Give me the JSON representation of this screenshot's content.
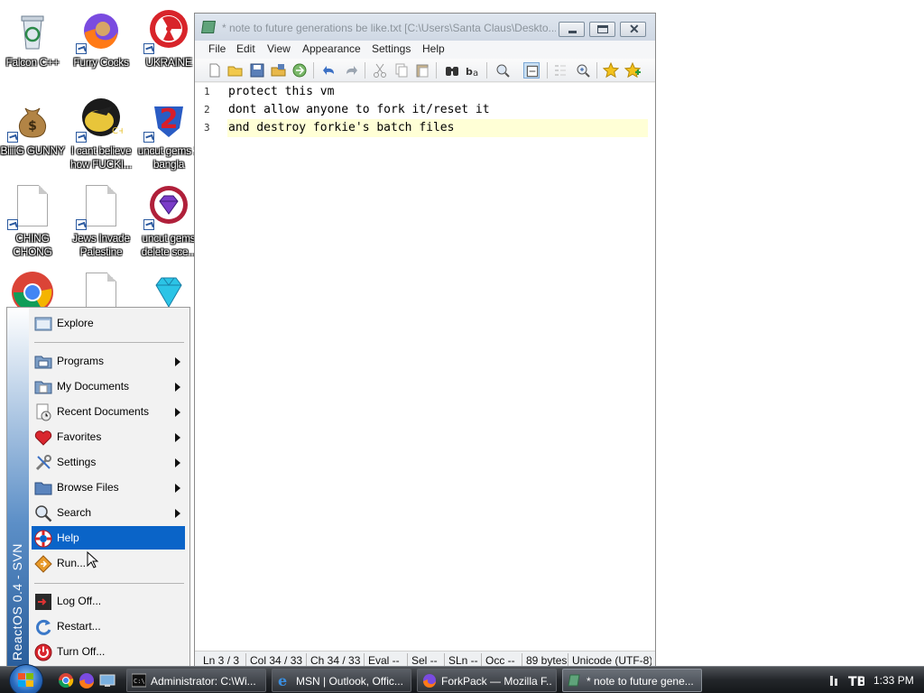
{
  "desktop": {
    "icons": [
      {
        "label": "Falcon C++",
        "icon": "recycle-bin-icon"
      },
      {
        "label": "Furry Cocks",
        "icon": "firefox-icon"
      },
      {
        "label": "UKRAINE",
        "icon": "radiation-icon"
      },
      {
        "label": "BiiiiG GUNNY",
        "icon": "money-bag-icon"
      },
      {
        "label": "I cant believe how FUCKI...",
        "icon": "chick-icon"
      },
      {
        "label": "uncut gems 2 bangla",
        "icon": "number-two-icon"
      },
      {
        "label": "CHING CHONG",
        "icon": "document-icon"
      },
      {
        "label": "Jews Invade Palestine",
        "icon": "document-icon"
      },
      {
        "label": "uncut gems delete sce...",
        "icon": "gem-icon"
      }
    ]
  },
  "editor": {
    "title": "* note to future generations be like.txt [C:\\Users\\Santa Claus\\Deskto...",
    "menu": [
      "File",
      "Edit",
      "View",
      "Appearance",
      "Settings",
      "Help"
    ],
    "lines": [
      {
        "num": "1",
        "text": "protect this vm"
      },
      {
        "num": "2",
        "text": "dont allow anyone to fork it/reset it"
      },
      {
        "num": "3",
        "text": "and destroy forkie's batch files"
      }
    ],
    "status": {
      "ln": "Ln 3 / 3",
      "col": "Col 34 / 33",
      "ch": "Ch 34 / 33",
      "eval": "Eval --",
      "sel": "Sel --",
      "sln": "SLn --",
      "occ": "Occ --",
      "size": "89 bytes",
      "encoding": "Unicode (UTF-8)"
    }
  },
  "start_menu": {
    "brand": "ReactOS 0.4 - SVN",
    "items": [
      {
        "label": "Explore",
        "icon": "explorer-icon"
      },
      {
        "label": "Programs",
        "icon": "programs-folder-icon",
        "submenu": true
      },
      {
        "label": "My Documents",
        "icon": "documents-folder-icon",
        "submenu": true
      },
      {
        "label": "Recent Documents",
        "icon": "recent-documents-icon",
        "submenu": true
      },
      {
        "label": "Favorites",
        "icon": "heart-icon",
        "submenu": true
      },
      {
        "label": "Settings",
        "icon": "settings-tools-icon",
        "submenu": true
      },
      {
        "label": "Browse Files",
        "icon": "folder-icon",
        "submenu": true
      },
      {
        "label": "Search",
        "icon": "magnifier-icon",
        "submenu": true
      },
      {
        "label": "Help",
        "icon": "lifebuoy-icon",
        "selected": true
      },
      {
        "label": "Run...",
        "icon": "run-icon"
      },
      {
        "label": "Log Off...",
        "icon": "log-off-icon"
      },
      {
        "label": "Restart...",
        "icon": "restart-icon"
      },
      {
        "label": "Turn Off...",
        "icon": "power-icon"
      }
    ]
  },
  "taskbar": {
    "tasks": [
      {
        "label": "Administrator: C:\\Wi...",
        "icon": "console-icon"
      },
      {
        "label": "MSN | Outlook, Offic...",
        "icon": "ie-icon"
      },
      {
        "label": "ForkPack — Mozilla F...",
        "icon": "firefox-icon"
      },
      {
        "label": "* note to future gene...",
        "icon": "notepad-icon",
        "active": true
      }
    ],
    "clock": "1:33 PM"
  },
  "colors": {
    "selection": "#0a64c8",
    "current_line": "#ffffd6",
    "taskbar": "#23262a"
  }
}
